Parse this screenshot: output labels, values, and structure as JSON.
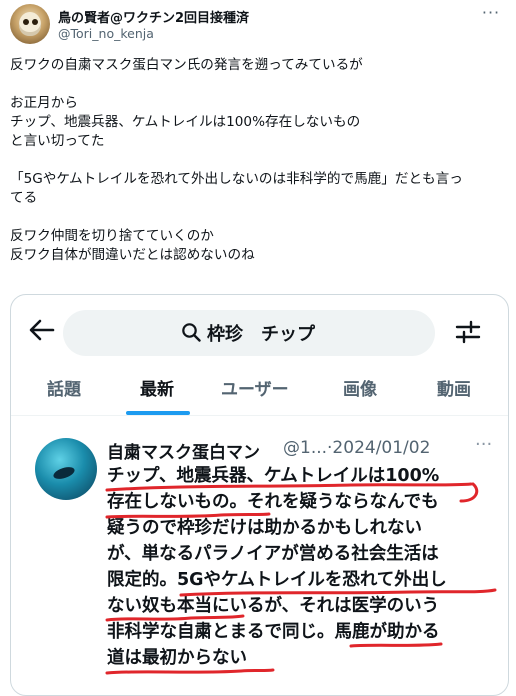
{
  "post": {
    "display_name": "鳥の賢者@ワクチン2回目接種済",
    "handle": "@Tori_no_kenja",
    "more_label": "···",
    "body_lines": [
      "反ワクの自粛マスク蛋白マン氏の発言を遡ってみているが",
      "",
      "お正月から",
      "チップ、地震兵器、ケムトレイルは100%存在しないもの",
      "と言い切ってた",
      "",
      "「5Gやケムトレイルを恐れて外出しないのは非科学的で馬鹿」だとも言っ",
      "てる",
      "",
      "反ワク仲間を切り捨てていくのか",
      "反ワク自体が間違いだとは認めないのね"
    ]
  },
  "screenshot": {
    "search_query": "枠珍　チップ",
    "tabs": [
      {
        "label": "話題"
      },
      {
        "label": "最新"
      },
      {
        "label": "ユーザー"
      },
      {
        "label": "画像"
      },
      {
        "label": "動画"
      }
    ],
    "active_tab": "最新",
    "accent_color": "#1d9bf0",
    "underline_color": "#e0262b",
    "embedded_post": {
      "author": "自粛マスク蛋白マン",
      "handle_date": "@1...·2024/01/02",
      "more_label": "···",
      "text_lines": [
        "チップ、地震兵器、ケムトレイルは100%",
        "存在しないもの。それを疑うならなんでも",
        "疑うので枠珍だけは助かるかもしれない",
        "が、単なるパラノイアが営める社会生活は",
        "限定的。5Gやケムトレイルを恐れて外出し",
        "ない奴も本当にいるが、それは医学のいう",
        "非科学な自粛とまるで同じ。馬鹿が助かる",
        "道は最初からない"
      ]
    }
  }
}
